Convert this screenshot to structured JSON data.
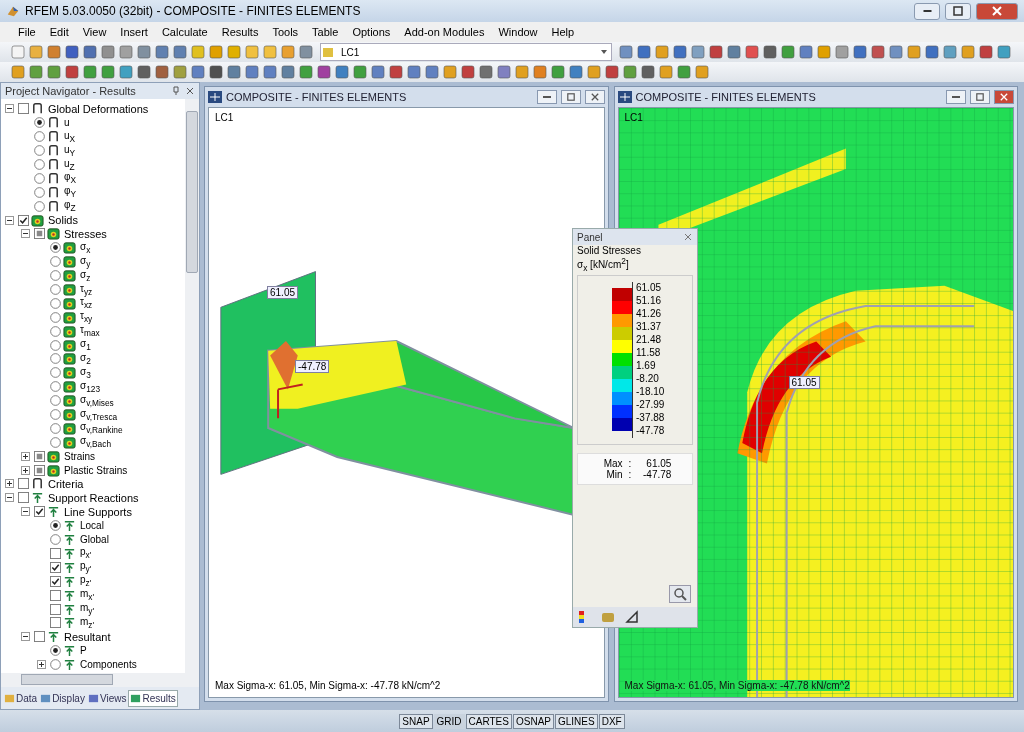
{
  "window": {
    "title": "RFEM 5.03.0050 (32bit) - COMPOSITE - FINITES ELEMENTS"
  },
  "menu": [
    "File",
    "Edit",
    "View",
    "Insert",
    "Calculate",
    "Results",
    "Tools",
    "Table",
    "Options",
    "Add-on Modules",
    "Window",
    "Help"
  ],
  "toolbar": {
    "load_case": "LC1"
  },
  "navigator": {
    "title": "Project Navigator - Results",
    "tree": [
      {
        "label": "Global Deformations",
        "kind": "checkbox",
        "checked": false,
        "mixed": false,
        "expanded": true,
        "children": [
          {
            "label": "u",
            "kind": "radio",
            "selected": true
          },
          {
            "label": "u$_{X}$",
            "kind": "radio",
            "selected": false
          },
          {
            "label": "u$_{Y}$",
            "kind": "radio",
            "selected": false
          },
          {
            "label": "u$_{Z}$",
            "kind": "radio",
            "selected": false
          },
          {
            "label": "φ$_{X}$",
            "kind": "radio",
            "selected": false
          },
          {
            "label": "φ$_{Y}$",
            "kind": "radio",
            "selected": false
          },
          {
            "label": "φ$_{Z}$",
            "kind": "radio",
            "selected": false
          }
        ]
      },
      {
        "label": "Solids",
        "kind": "checkbox",
        "checked": true,
        "mixed": false,
        "expanded": true,
        "children": [
          {
            "label": "Stresses",
            "kind": "checkbox",
            "checked": false,
            "mixed": true,
            "expanded": true,
            "children": [
              {
                "label": "σ$_{x}$",
                "kind": "radio",
                "selected": true
              },
              {
                "label": "σ$_{y}$",
                "kind": "radio",
                "selected": false
              },
              {
                "label": "σ$_{z}$",
                "kind": "radio",
                "selected": false
              },
              {
                "label": "τ$_{yz}$",
                "kind": "radio",
                "selected": false
              },
              {
                "label": "τ$_{xz}$",
                "kind": "radio",
                "selected": false
              },
              {
                "label": "τ$_{xy}$",
                "kind": "radio",
                "selected": false
              },
              {
                "label": "τ$_{max}$",
                "kind": "radio",
                "selected": false
              },
              {
                "label": "σ$_{1}$",
                "kind": "radio",
                "selected": false
              },
              {
                "label": "σ$_{2}$",
                "kind": "radio",
                "selected": false
              },
              {
                "label": "σ$_{3}$",
                "kind": "radio",
                "selected": false
              },
              {
                "label": "σ$_{123}$",
                "kind": "radio",
                "selected": false
              },
              {
                "label": "σ$_{v,Mises}$",
                "kind": "radio",
                "selected": false
              },
              {
                "label": "σ$_{v,Tresca}$",
                "kind": "radio",
                "selected": false
              },
              {
                "label": "σ$_{v,Rankine}$",
                "kind": "radio",
                "selected": false
              },
              {
                "label": "σ$_{v,Bach}$",
                "kind": "radio",
                "selected": false
              }
            ]
          },
          {
            "label": "Strains",
            "kind": "checkbox",
            "checked": false,
            "mixed": true,
            "expanded": false
          },
          {
            "label": "Plastic Strains",
            "kind": "checkbox",
            "checked": false,
            "mixed": true,
            "expanded": false
          }
        ]
      },
      {
        "label": "Criteria",
        "kind": "checkbox",
        "checked": false,
        "mixed": false,
        "expanded": false
      },
      {
        "label": "Support Reactions",
        "kind": "checkbox",
        "checked": false,
        "mixed": false,
        "expanded": true,
        "children": [
          {
            "label": "Line Supports",
            "kind": "checkbox",
            "checked": true,
            "mixed": false,
            "expanded": true,
            "children": [
              {
                "label": "Local",
                "kind": "radio",
                "selected": true
              },
              {
                "label": "Global",
                "kind": "radio",
                "selected": false
              },
              {
                "label": "p$_{x'}$",
                "kind": "checkbox",
                "checked": false,
                "mixed": false
              },
              {
                "label": "p$_{y'}$",
                "kind": "checkbox",
                "checked": true,
                "mixed": false
              },
              {
                "label": "p$_{z'}$",
                "kind": "checkbox",
                "checked": true,
                "mixed": false
              },
              {
                "label": "m$_{x'}$",
                "kind": "checkbox",
                "checked": false,
                "mixed": false
              },
              {
                "label": "m$_{y'}$",
                "kind": "checkbox",
                "checked": false,
                "mixed": false
              },
              {
                "label": "m$_{z'}$",
                "kind": "checkbox",
                "checked": false,
                "mixed": false
              }
            ]
          },
          {
            "label": "Resultant",
            "kind": "checkbox",
            "checked": false,
            "mixed": false,
            "expanded": true,
            "children": [
              {
                "label": "P",
                "kind": "radio",
                "selected": true
              },
              {
                "label": "Components",
                "kind": "radio",
                "selected": false,
                "expanded": false
              }
            ]
          }
        ]
      }
    ],
    "tabs": [
      {
        "label": "Data",
        "selected": false
      },
      {
        "label": "Display",
        "selected": false
      },
      {
        "label": "Views",
        "selected": false
      },
      {
        "label": "Results",
        "selected": true
      }
    ]
  },
  "windows": [
    {
      "title": "COMPOSITE - FINITES ELEMENTS",
      "kind": "model",
      "load_case": "LC1",
      "labels": [
        "61.05",
        "-47.78"
      ],
      "footer": "Max Sigma-x: 61.05, Min Sigma-x: -47.78 kN/cm^2"
    },
    {
      "title": "COMPOSITE - FINITES ELEMENTS",
      "kind": "zoom",
      "load_case": "LC1",
      "labels": [
        "61.05"
      ],
      "footer": "Max Sigma-x: 61.05, Min Sigma-x: -47.78 kN/cm^2"
    }
  ],
  "panel": {
    "title": "Panel",
    "heading": "Solid Stresses",
    "quantity": "σ$_{x}$ [kN/cm$^{2}$]",
    "values": [
      "61.05",
      "51.16",
      "41.26",
      "31.37",
      "21.48",
      "11.58",
      "1.69",
      "-8.20",
      "-18.10",
      "-27.99",
      "-37.88",
      "-47.78"
    ],
    "bands": [
      {
        "color": "#c00000"
      },
      {
        "color": "#ff0000"
      },
      {
        "color": "#ff9900"
      },
      {
        "color": "#cccc00"
      },
      {
        "color": "#ffff00"
      },
      {
        "color": "#00e000"
      },
      {
        "color": "#00d080"
      },
      {
        "color": "#00e8e8"
      },
      {
        "color": "#0090ff"
      },
      {
        "color": "#0030ff"
      },
      {
        "color": "#0000b0"
      }
    ],
    "max_label": "Max",
    "max_separator": ":",
    "max": "61.05",
    "min_label": "Min",
    "min_separator": ":",
    "min": "-47.78"
  },
  "status_bar": [
    {
      "label": "SNAP",
      "selected": false
    },
    {
      "label": "GRID",
      "selected": true
    },
    {
      "label": "CARTES",
      "selected": false
    },
    {
      "label": "OSNAP",
      "selected": false
    },
    {
      "label": "GLINES",
      "selected": false
    },
    {
      "label": "DXF",
      "selected": false
    }
  ]
}
